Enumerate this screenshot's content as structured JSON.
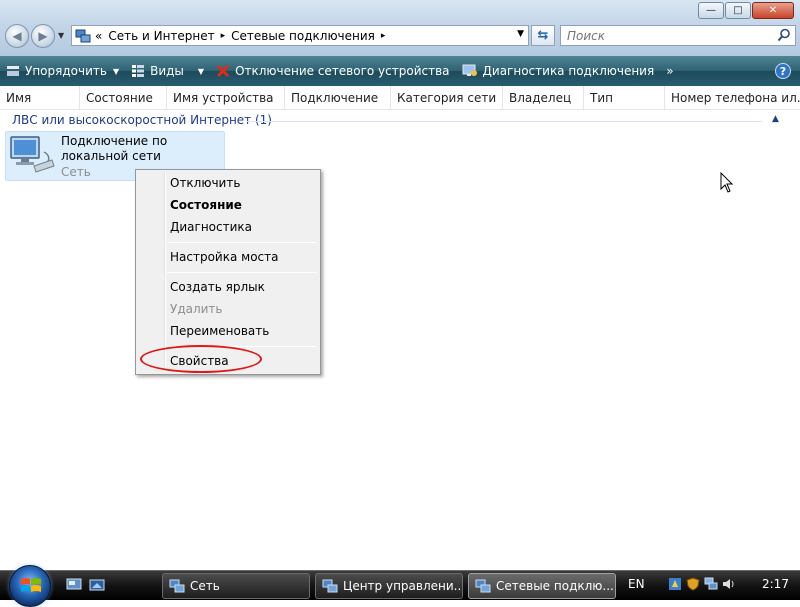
{
  "window": {
    "controls": {
      "minimize": "—",
      "maximize": "□",
      "close": "✕"
    }
  },
  "address": {
    "chevron": "«",
    "crumbs": [
      "Сеть и Интернет",
      "Сетевые подключения"
    ],
    "sep": "▸",
    "search_placeholder": "Поиск"
  },
  "toolbar": {
    "organize": "Упорядочить",
    "views": "Виды",
    "disable": "Отключение сетевого устройства",
    "diagnose": "Диагностика подключения",
    "more": "»",
    "help": "?"
  },
  "columns": [
    "Имя",
    "Состояние",
    "Имя устройства",
    "Подключение",
    "Категория сети",
    "Владелец",
    "Тип",
    "Номер телефона ил..."
  ],
  "content": {
    "group_title": "ЛВС или высокоскоростной Интернет (1)",
    "item": {
      "name": "Подключение по локальной сети",
      "subtitle": "Сеть"
    }
  },
  "context_menu": {
    "items": [
      {
        "label": "Отключить"
      },
      {
        "label": "Состояние"
      },
      {
        "label": "Диагностика"
      },
      {
        "label": "Настройка моста"
      },
      {
        "label": "Создать ярлык"
      },
      {
        "label": "Удалить"
      },
      {
        "label": "Переименовать"
      },
      {
        "label": "Свойства"
      }
    ]
  },
  "taskbar": {
    "tasks": [
      {
        "label": "Сеть",
        "active": false
      },
      {
        "label": "Центр управлени...",
        "active": false
      },
      {
        "label": "Сетевые подклю...",
        "active": true
      }
    ],
    "language": "EN",
    "clock": "2:17"
  },
  "colors": {
    "toolbar": "#2e6273",
    "selection": "#dceefc",
    "group_text": "#1e3c8c",
    "annotation": "#e01818"
  }
}
